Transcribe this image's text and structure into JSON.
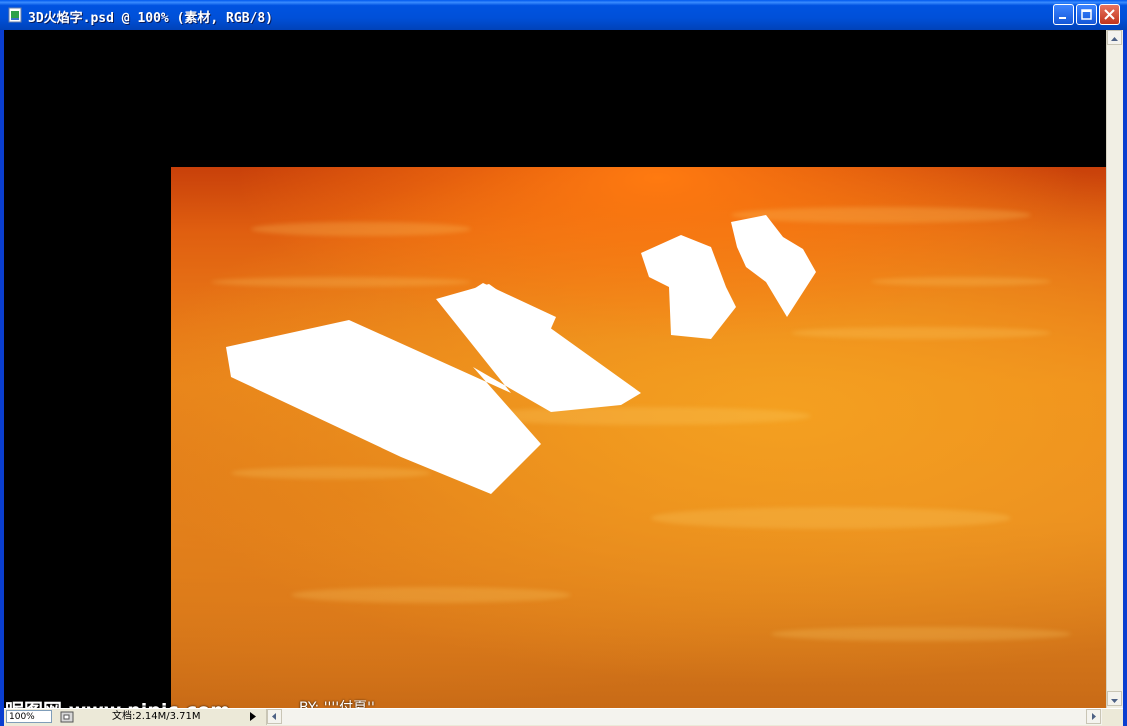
{
  "window": {
    "title": "3D火焰字.psd @ 100% (素材, RGB/8)",
    "icon": "photoshop-doc-icon"
  },
  "canvas": {
    "text_shape": "Nic"
  },
  "statusbar": {
    "zoom": "100%",
    "doc_info": "文档:2.14M/3.71M"
  },
  "watermark": {
    "site": "昵图网 www.nipic.com",
    "credit": "BY: ''''付夏''"
  },
  "colors": {
    "titlebar": "#0054e3",
    "canvas_bg": "#000000",
    "fire_orange": "#ee8a1c",
    "fire_red": "#c8400a",
    "letters": "#ffffff"
  }
}
